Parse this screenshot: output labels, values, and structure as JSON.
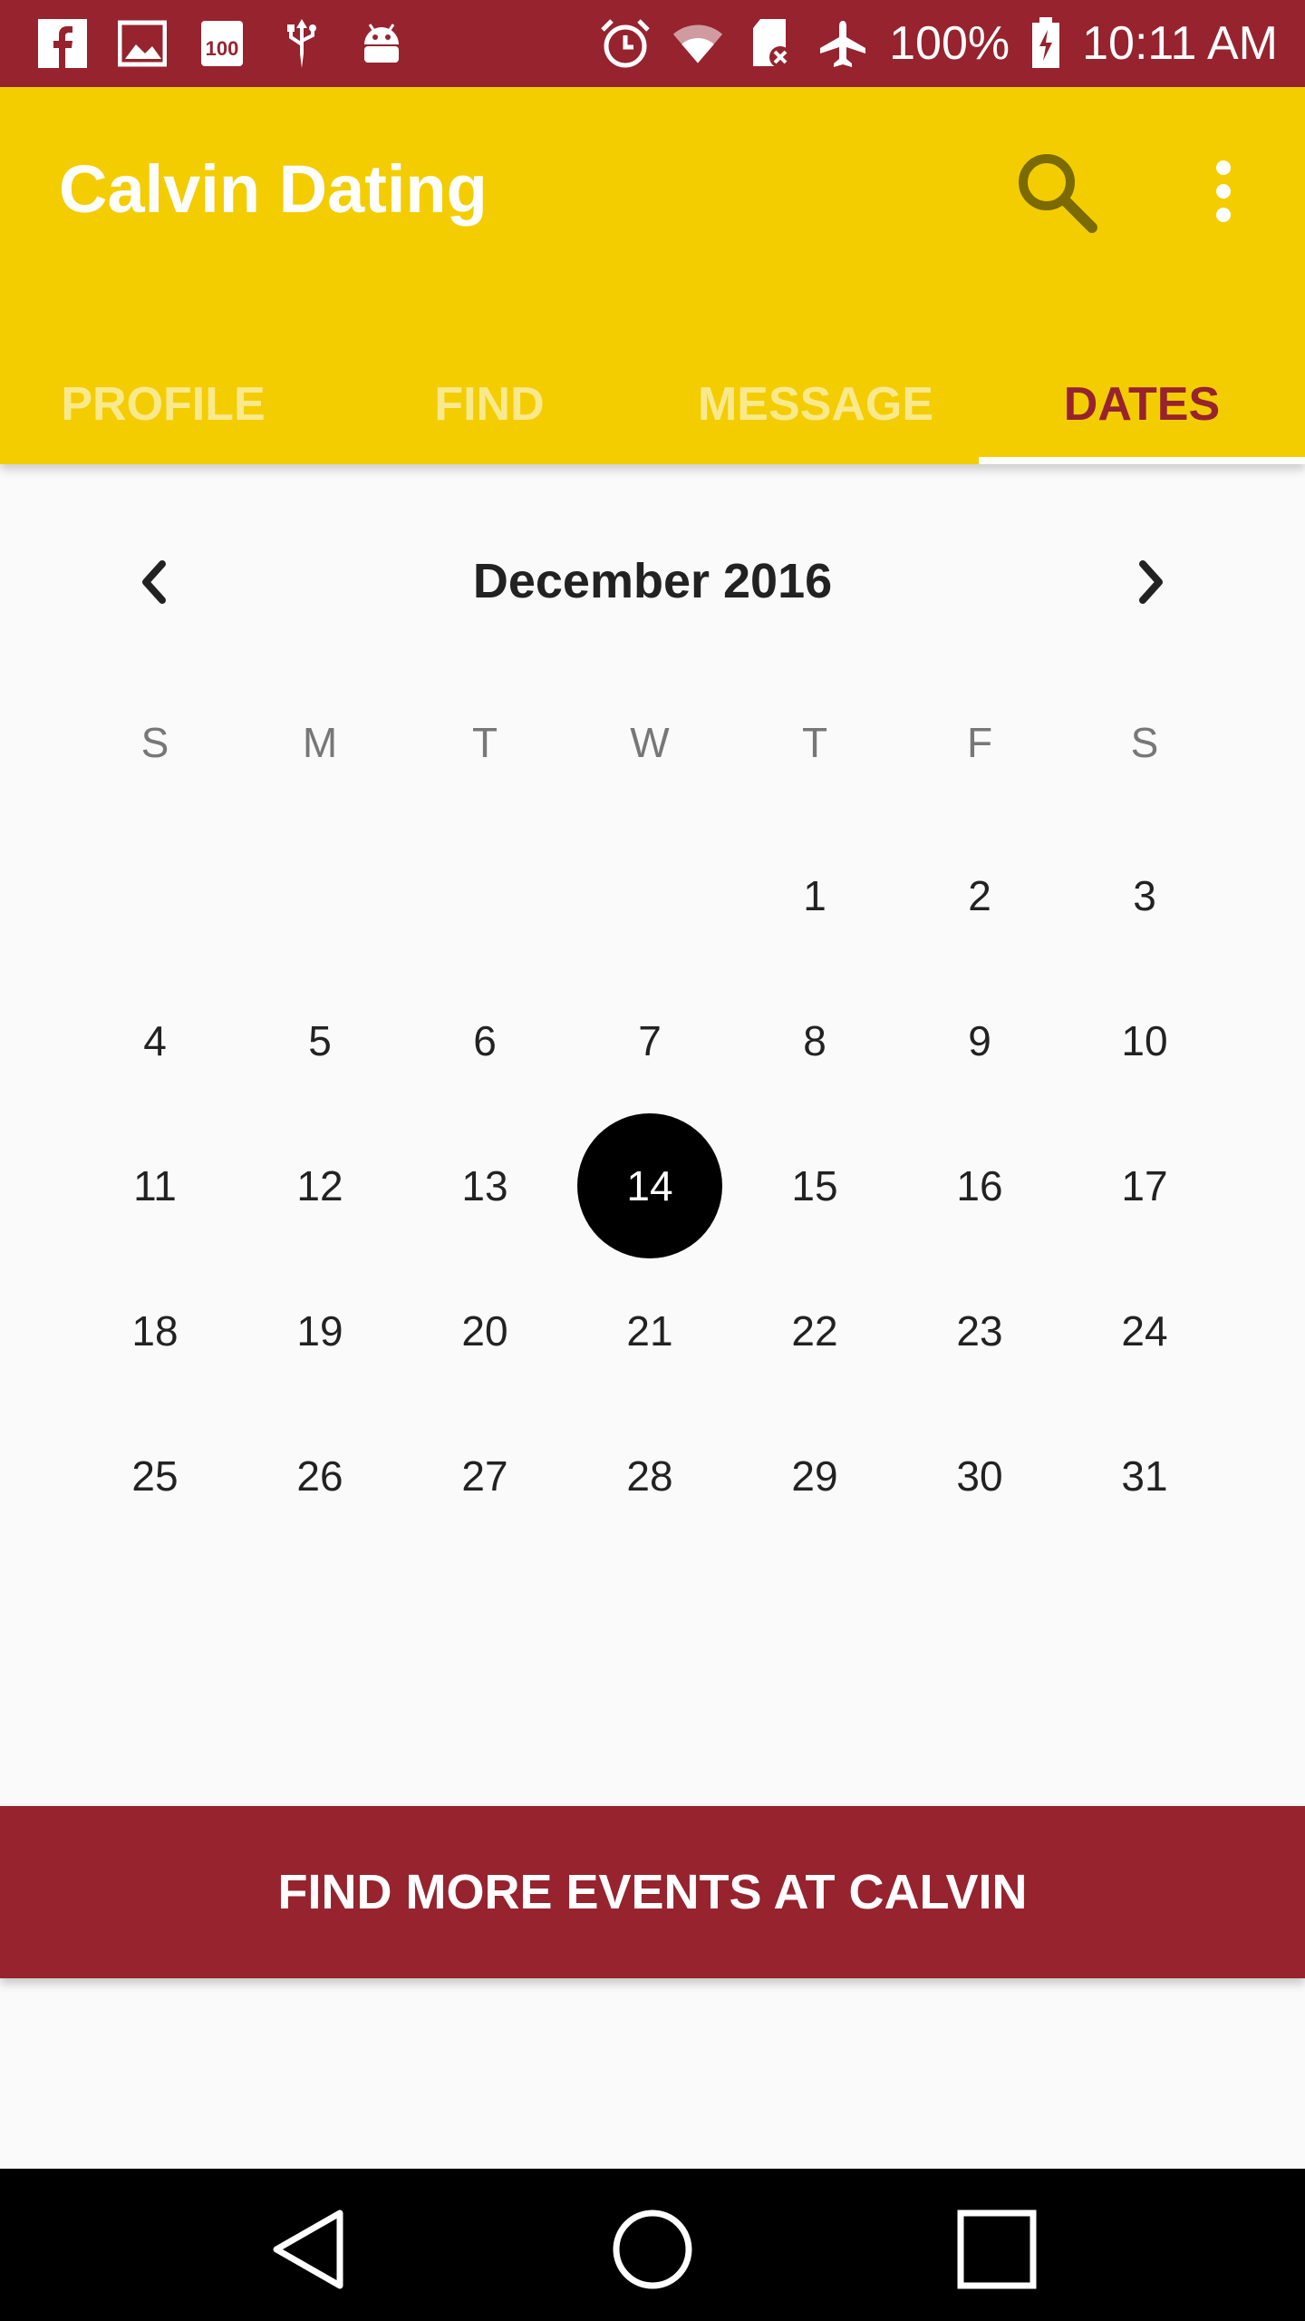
{
  "status_bar": {
    "battery": "100%",
    "time": "10:11 AM",
    "left_icons": [
      "facebook-icon",
      "image-icon",
      "speed-100-icon",
      "usb-icon",
      "android-icon"
    ],
    "right_icons": [
      "alarm-icon",
      "wifi-icon",
      "sd-card-icon",
      "airplane-icon",
      "battery-icon"
    ]
  },
  "app_bar": {
    "title": "Calvin Dating",
    "actions": [
      "search-icon",
      "more-vert-icon"
    ]
  },
  "tabs": [
    {
      "label": "PROFILE",
      "active": false
    },
    {
      "label": "FIND",
      "active": false
    },
    {
      "label": "MESSAGE",
      "active": false
    },
    {
      "label": "DATES",
      "active": true
    }
  ],
  "calendar": {
    "month_label": "December 2016",
    "weekdays": [
      "S",
      "M",
      "T",
      "W",
      "T",
      "F",
      "S"
    ],
    "leading_blanks": 4,
    "days": [
      "1",
      "2",
      "3",
      "4",
      "5",
      "6",
      "7",
      "8",
      "9",
      "10",
      "11",
      "12",
      "13",
      "14",
      "15",
      "16",
      "17",
      "18",
      "19",
      "20",
      "21",
      "22",
      "23",
      "24",
      "25",
      "26",
      "27",
      "28",
      "29",
      "30",
      "31"
    ],
    "selected_day": "14"
  },
  "events_button": {
    "label": "FIND MORE EVENTS AT CALVIN"
  },
  "nav_bar": {
    "buttons": [
      "back-icon",
      "home-icon",
      "recents-icon"
    ]
  },
  "colors": {
    "status_bar": "#96232e",
    "app_bar": "#f3cd00",
    "tab_inactive": "#fae98c",
    "tab_active": "#96232e",
    "button": "#96232e",
    "selected_day": "#000000"
  }
}
